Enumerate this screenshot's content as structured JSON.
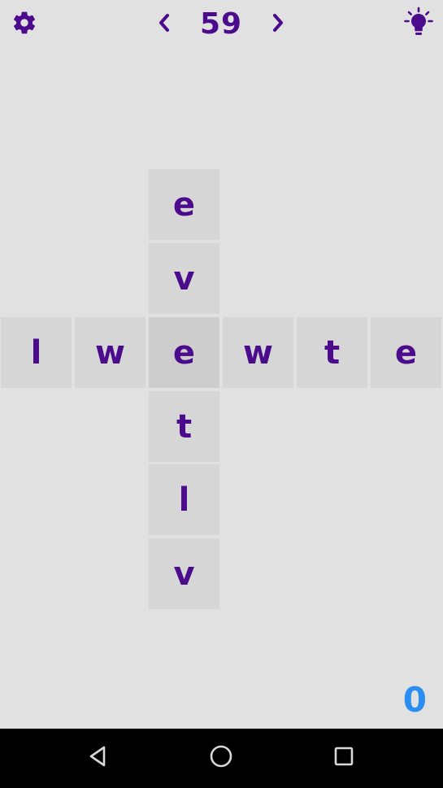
{
  "header": {
    "level": "59",
    "icons": {
      "settings": "gear-icon",
      "prev": "chevron-left-icon",
      "next": "chevron-right-icon",
      "hint": "lightbulb-icon"
    }
  },
  "board": {
    "vertical_word": [
      "e",
      "v",
      "e",
      "t",
      "l",
      "v"
    ],
    "horizontal_word": [
      "l",
      "w",
      "e",
      "w",
      "t",
      "e"
    ],
    "intersection_letter": "e"
  },
  "score": "0",
  "colors": {
    "background": "#e1e1e1",
    "tile": "#d6d6d6",
    "letter": "#4b0b8c",
    "score": "#2a8ef0"
  },
  "navbar": {
    "icons": [
      "back-triangle-icon",
      "home-circle-icon",
      "recents-square-icon"
    ]
  }
}
